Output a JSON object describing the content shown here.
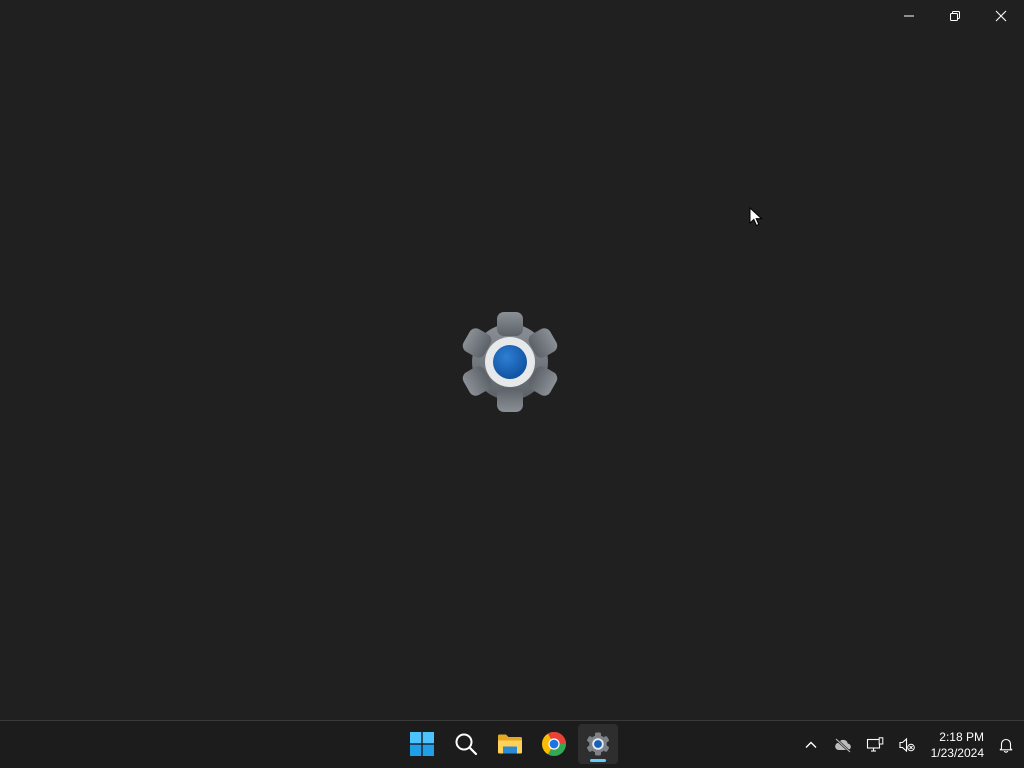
{
  "window": {
    "caption_buttons": [
      {
        "name": "minimize-button",
        "icon": "minimize-icon"
      },
      {
        "name": "restore-button",
        "icon": "restore-icon"
      },
      {
        "name": "close-button",
        "icon": "close-icon"
      }
    ],
    "splash_icon": "settings-gear-icon",
    "background_color": "#202020"
  },
  "taskbar": {
    "pinned": [
      {
        "name": "start-button",
        "icon": "windows-logo-icon",
        "active": false
      },
      {
        "name": "search-button",
        "icon": "search-icon",
        "active": false
      },
      {
        "name": "file-explorer-button",
        "icon": "folder-icon",
        "active": false
      },
      {
        "name": "chrome-button",
        "icon": "chrome-icon",
        "active": false
      },
      {
        "name": "settings-button",
        "icon": "settings-gear-icon",
        "active": true
      }
    ],
    "tray_icons": [
      {
        "name": "show-hidden-icons-button",
        "icon": "chevron-up-icon"
      },
      {
        "name": "onedrive-button",
        "icon": "cloud-offline-icon"
      },
      {
        "name": "network-button",
        "icon": "network-icon"
      },
      {
        "name": "volume-button",
        "icon": "speaker-muted-icon"
      }
    ],
    "clock": {
      "time": "2:18 PM",
      "date": "1/23/2024"
    },
    "notification_icon": "bell-icon",
    "accent_color": "#60cdff"
  }
}
